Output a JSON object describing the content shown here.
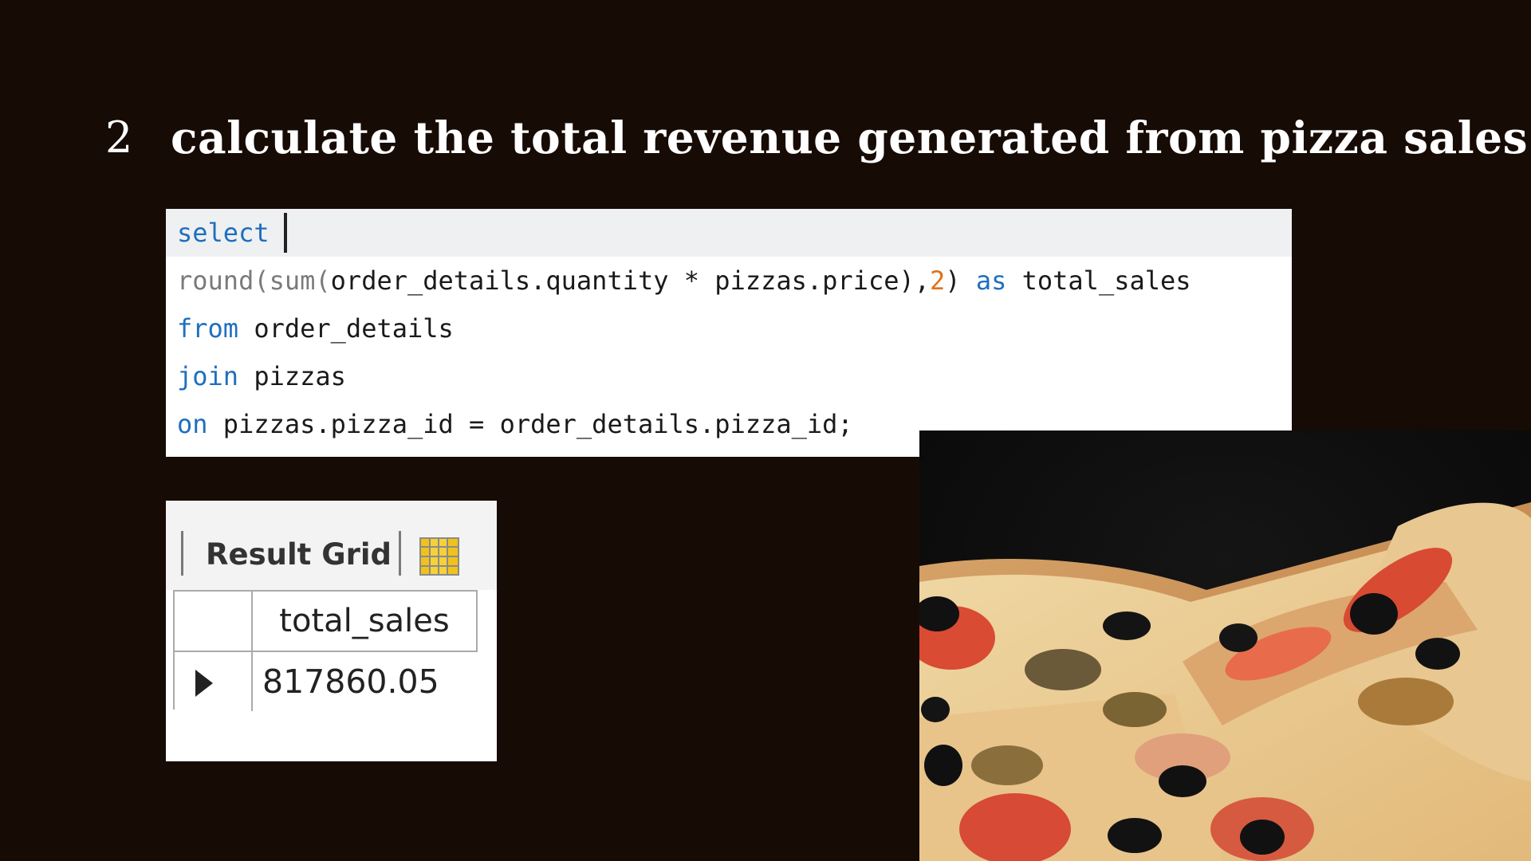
{
  "slide": {
    "number": "2",
    "title": "calculate the total revenue generated from pizza sales."
  },
  "query": {
    "line1": {
      "kw": "select"
    },
    "line2": {
      "fn1": "round(",
      "fn2": "sum(",
      "expr": "order_details.quantity * pizzas.price),",
      "num": "2",
      "close": ")",
      "as": " as ",
      "alias": "total_sales"
    },
    "line3": {
      "kw": "from",
      "rest": " order_details"
    },
    "line4": {
      "kw": "join",
      "rest": " pizzas"
    },
    "line5": {
      "kw": "on",
      "rest": " pizzas.pizza_id = order_details.pizza_id;"
    }
  },
  "result_grid": {
    "label": "Result Grid",
    "icon": "grid-layout-icon",
    "column_header": "total_sales",
    "rows": [
      {
        "total_sales": "817860.05"
      }
    ]
  },
  "colors": {
    "background": "#170b05",
    "keyword": "#1f6fbf",
    "number_literal": "#e0711a"
  },
  "image": {
    "subject": "pizza-photo"
  }
}
